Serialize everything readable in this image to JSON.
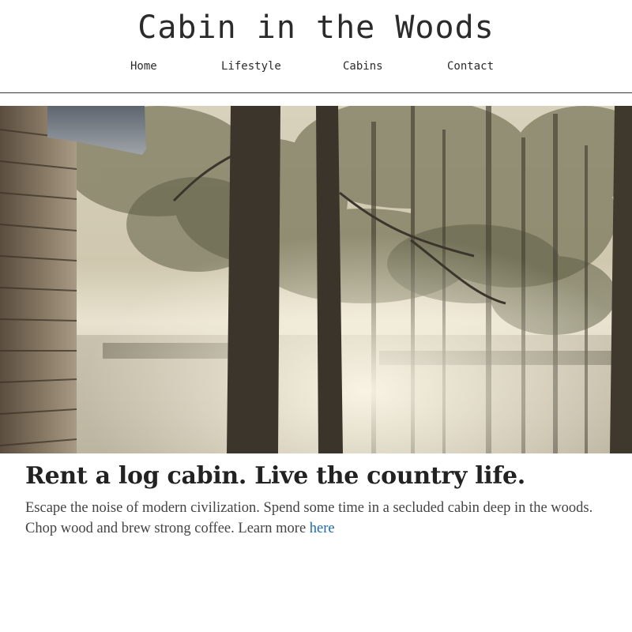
{
  "site": {
    "title": "Cabin in the Woods"
  },
  "nav": {
    "items": [
      "Home",
      "Lifestyle",
      "Cabins",
      "Contact"
    ]
  },
  "hero": {
    "description": "misty forest at a lake beside a log cabin wall"
  },
  "main": {
    "headline": "Rent a log cabin. Live the country life.",
    "body_text": "Escape the noise of modern civilization. Spend some time in a secluded cabin deep in the woods. Chop wood and brew strong coffee. Learn more ",
    "link_label": "here",
    "link_color": "#1e6aa6"
  }
}
